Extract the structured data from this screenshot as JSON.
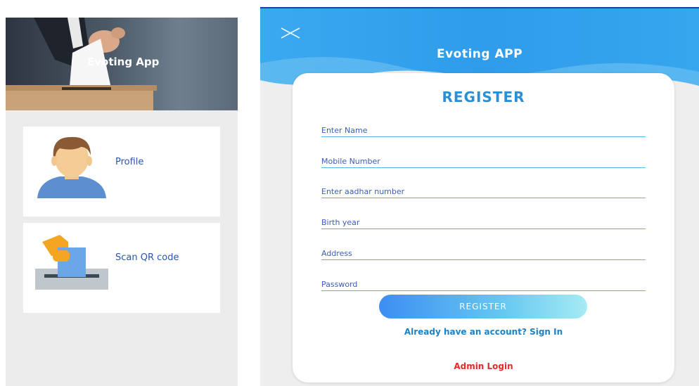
{
  "left_screen": {
    "hero": {
      "title": "Evoting App"
    },
    "menu": [
      {
        "label": "Profile",
        "icon": "profile-avatar-icon"
      },
      {
        "label": "Scan QR code",
        "icon": "ballot-box-icon"
      }
    ]
  },
  "right_screen": {
    "header": {
      "title": "Evoting APP",
      "close_icon": "close-icon"
    },
    "form": {
      "heading": "REGISTER",
      "fields": [
        {
          "placeholder": "Enter Name",
          "value": ""
        },
        {
          "placeholder": "Mobile Number",
          "value": ""
        },
        {
          "placeholder": "Enter aadhar number",
          "value": ""
        },
        {
          "placeholder": "Birth year",
          "value": ""
        },
        {
          "placeholder": "Address",
          "value": ""
        },
        {
          "placeholder": "Password",
          "value": ""
        }
      ],
      "register_button": "REGISTER",
      "signin_link": "Already have an account? Sign In",
      "admin_link": "Admin Login"
    }
  },
  "colors": {
    "header_blue": "#3aa7ee",
    "register_heading": "#2b8fd6",
    "field_text": "#3b5fb5",
    "signin_link": "#1e83c4",
    "admin_link": "#e22a2a"
  }
}
